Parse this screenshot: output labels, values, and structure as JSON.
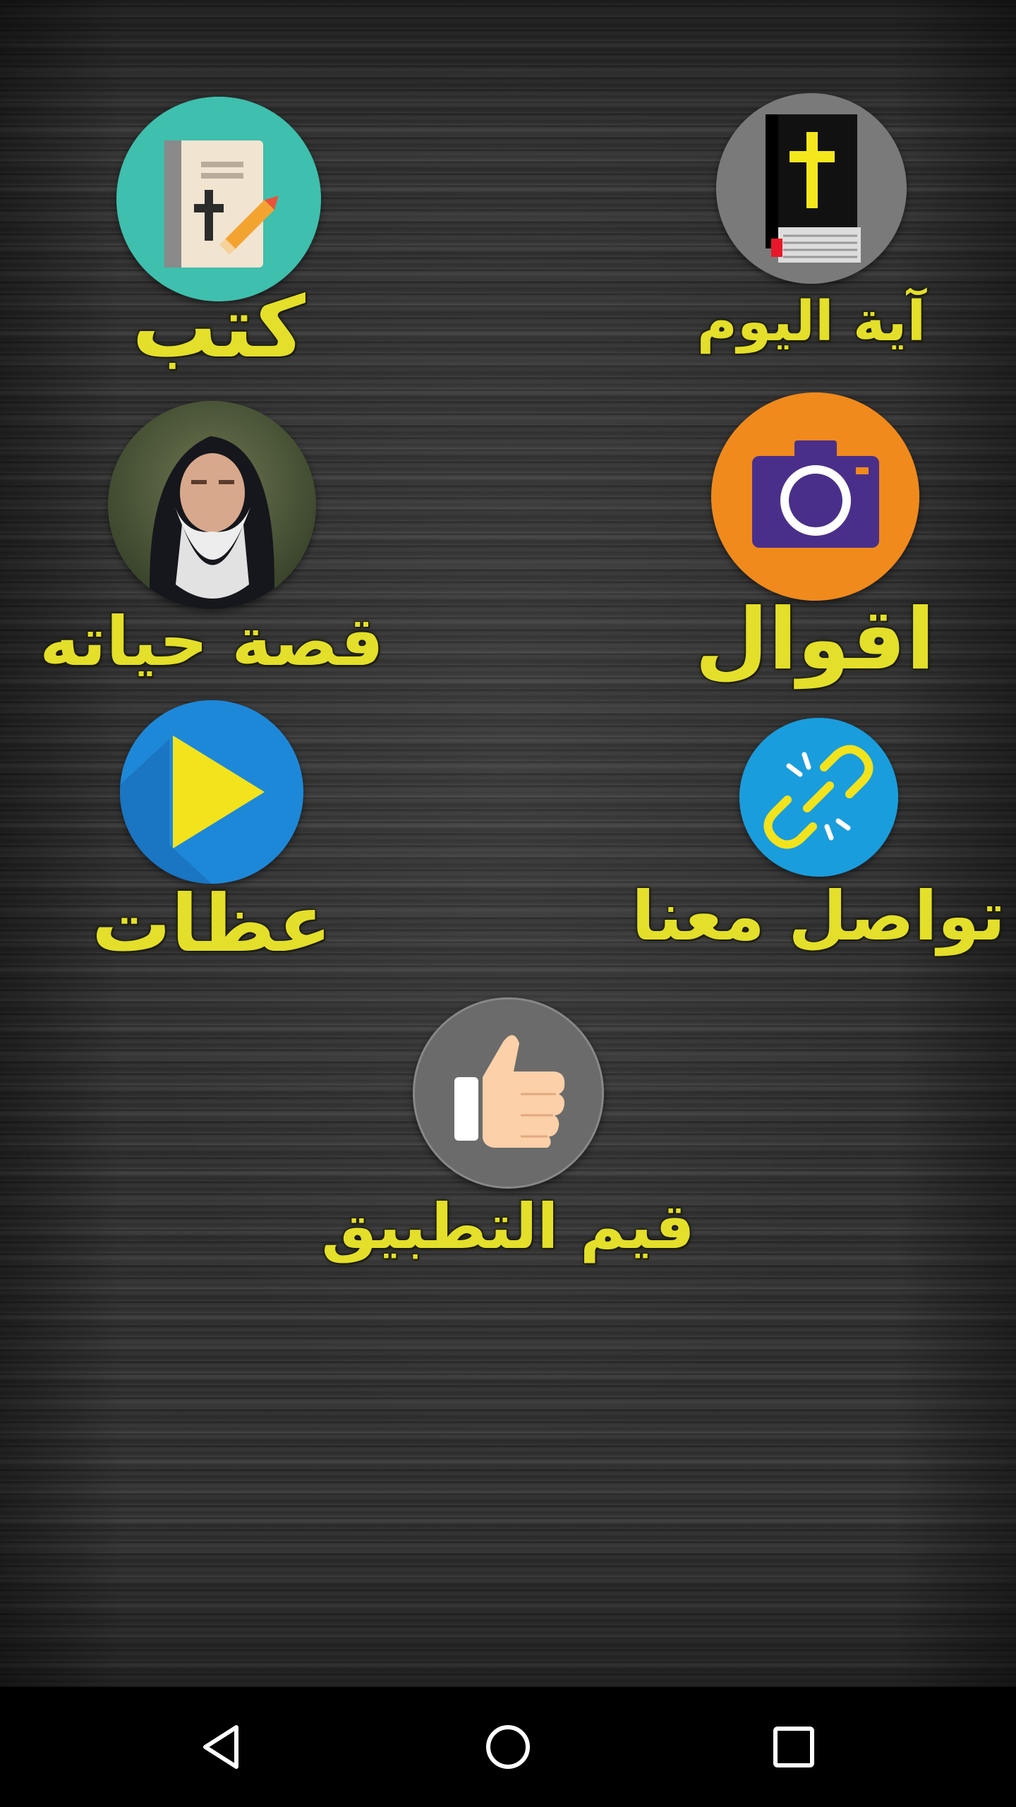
{
  "menu": {
    "verse_of_day": {
      "label": "آية اليوم",
      "icon": "bible-cross-icon"
    },
    "books": {
      "label": "كتب",
      "icon": "book-cross-pencil-icon"
    },
    "sayings": {
      "label": "اقوال",
      "icon": "camera-icon"
    },
    "life_story": {
      "label": "قصة حياته",
      "icon": "monk-portrait"
    },
    "contact_us": {
      "label": "تواصل معنا",
      "icon": "broken-link-icon"
    },
    "sermons": {
      "label": "عظات",
      "icon": "play-icon"
    },
    "rate_app": {
      "label": "قيم التطبيق",
      "icon": "thumbs-up-icon"
    }
  },
  "colors": {
    "label_yellow": "#e3df2a",
    "books_bg": "#3fbfad",
    "camera_bg": "#f08a1c",
    "camera_body": "#4a2f8a",
    "link_bg": "#1a9ddc",
    "play_bg": "#1e88d8",
    "play_triangle": "#f2e31c",
    "thumb_bg": "#6b6b6b",
    "thumb_skin": "#fcd0a8"
  },
  "navbar": {
    "back": "back-icon",
    "home": "home-icon",
    "recents": "recents-icon"
  }
}
